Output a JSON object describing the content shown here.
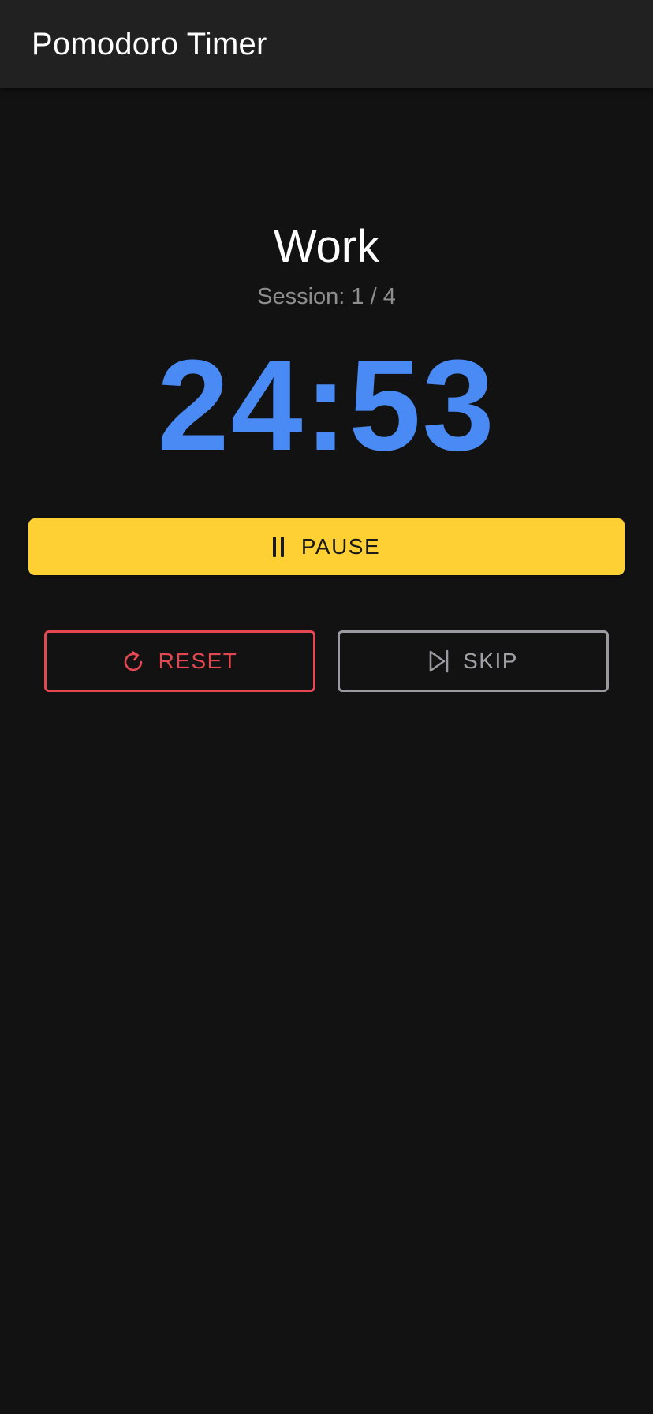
{
  "app_bar": {
    "title": "Pomodoro Timer"
  },
  "timer": {
    "phase": "Work",
    "session_text": "Session: 1 / 4",
    "time": "24:53"
  },
  "controls": {
    "pause": {
      "label": "PAUSE",
      "icon": "pause-icon"
    },
    "reset": {
      "label": "RESET",
      "icon": "refresh-icon"
    },
    "skip": {
      "label": "SKIP",
      "icon": "skip-next-icon"
    }
  },
  "colors": {
    "background": "#121212",
    "app_bar": "#212121",
    "timer": "#4a8af4",
    "pause_button": "#ffd033",
    "reset": "#e4474f",
    "skip": "#9a9aa0"
  }
}
